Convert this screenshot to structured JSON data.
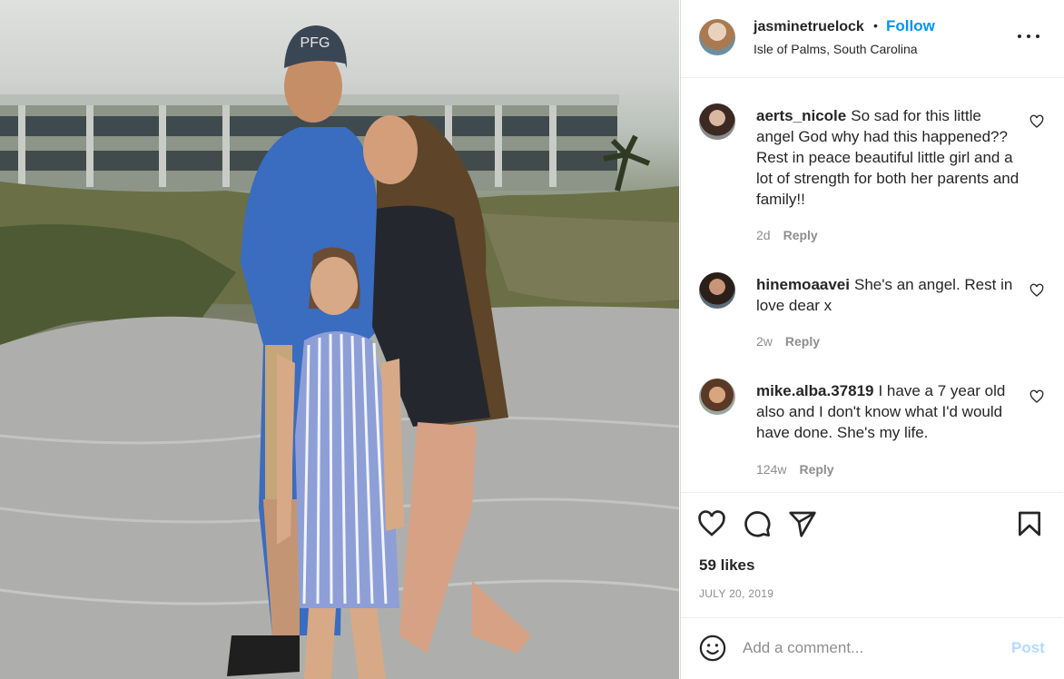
{
  "post": {
    "username": "jasminetruelock",
    "separator": "•",
    "follow_label": "Follow",
    "location": "Isle of Palms, South Carolina",
    "more_icon": "more-horizontal-icon"
  },
  "photo": {
    "cap_text": "PFG"
  },
  "comments": [
    {
      "username": "aerts_nicole",
      "text": "So sad for this little angel God why had this happened?? Rest in peace beautiful little girl and a lot of strength for both her parents and family!!",
      "time": "2d",
      "reply_label": "Reply"
    },
    {
      "username": "hinemoaavei",
      "text": "She's an angel. Rest in love dear x",
      "time": "2w",
      "reply_label": "Reply"
    },
    {
      "username": "mike.alba.37819",
      "text": "I have a 7 year old also and I don't know what I'd would have done. She's my life.",
      "time": "124w",
      "reply_label": "Reply"
    }
  ],
  "actions": {
    "like_icon": "heart-icon",
    "comment_icon": "comment-bubble-icon",
    "share_icon": "paper-plane-icon",
    "save_icon": "bookmark-icon"
  },
  "likes": "59 likes",
  "date": "JULY 20, 2019",
  "add_comment": {
    "placeholder": "Add a comment...",
    "post_label": "Post",
    "emoji_icon": "smiley-icon"
  },
  "colors": {
    "link_blue": "#0095f6",
    "post_disabled": "#b3dbff",
    "secondary_text": "#8e8e8e"
  }
}
